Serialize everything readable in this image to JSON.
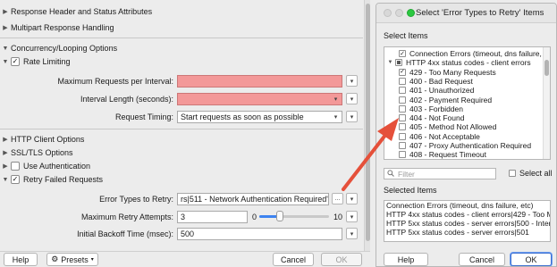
{
  "settings": {
    "response_header": "Response Header and Status Attributes",
    "multipart": "Multipart Response Handling",
    "concurrency": "Concurrency/Looping Options",
    "rate_limiting": "Rate Limiting",
    "max_requests_label": "Maximum Requests per Interval:",
    "max_requests_value": "",
    "interval_length_label": "Interval Length (seconds):",
    "interval_length_value": "",
    "request_timing_label": "Request Timing:",
    "request_timing_value": "Start requests as soon as possible",
    "http_client_options": "HTTP Client Options",
    "ssl_tls_options": "SSL/TLS Options",
    "use_authentication": "Use Authentication",
    "retry_failed": "Retry Failed Requests",
    "error_types_label": "Error Types to Retry:",
    "error_types_value": "rs|511 - Network Authentication Required\"",
    "browse_label": "...",
    "max_retry_label": "Maximum Retry Attempts:",
    "max_retry_value": "3",
    "slider_min": "0",
    "slider_max": "10",
    "slider_value": 3,
    "backoff_label": "Initial Backoff Time (msec):",
    "backoff_value": "500"
  },
  "footer_left": {
    "help": "Help",
    "presets": "Presets",
    "cancel": "Cancel",
    "ok": "OK"
  },
  "dialog": {
    "title": "Select 'Error Types to Retry' Items",
    "select_items_label": "Select Items",
    "tree": [
      {
        "label": "Connection Errors (timeout, dns failure, etc)",
        "checked": true,
        "level": 1
      },
      {
        "label": "HTTP 4xx status codes - client errors",
        "checked": "partial",
        "level": 0,
        "expanded": true
      },
      {
        "label": "429 - Too Many Requests",
        "checked": true,
        "level": 1
      },
      {
        "label": "400 - Bad Request",
        "checked": false,
        "level": 1
      },
      {
        "label": "401 - Unauthorized",
        "checked": false,
        "level": 1
      },
      {
        "label": "402 - Payment Required",
        "checked": false,
        "level": 1
      },
      {
        "label": "403 - Forbidden",
        "checked": false,
        "level": 1
      },
      {
        "label": "404 - Not Found",
        "checked": false,
        "level": 1
      },
      {
        "label": "405 - Method Not Allowed",
        "checked": false,
        "level": 1
      },
      {
        "label": "406 - Not Acceptable",
        "checked": false,
        "level": 1
      },
      {
        "label": "407 - Proxy Authentication Required",
        "checked": false,
        "level": 1
      },
      {
        "label": "408 - Request Timeout",
        "checked": false,
        "level": 1
      }
    ],
    "filter_placeholder": "Filter",
    "select_all": "Select all",
    "selected_items_label": "Selected Items",
    "selected": [
      "Connection Errors (timeout, dns failure, etc)",
      "HTTP 4xx status codes - client errors|429 - Too Many Requests",
      "HTTP 5xx status codes - server errors|500 - Internal Server Error",
      "HTTP 5xx status codes - server errors|501"
    ],
    "help": "Help",
    "cancel": "Cancel",
    "ok": "OK"
  },
  "colors": {
    "required_field": "#f39898",
    "arrow": "#e5503a",
    "accent": "#3d83f0"
  }
}
